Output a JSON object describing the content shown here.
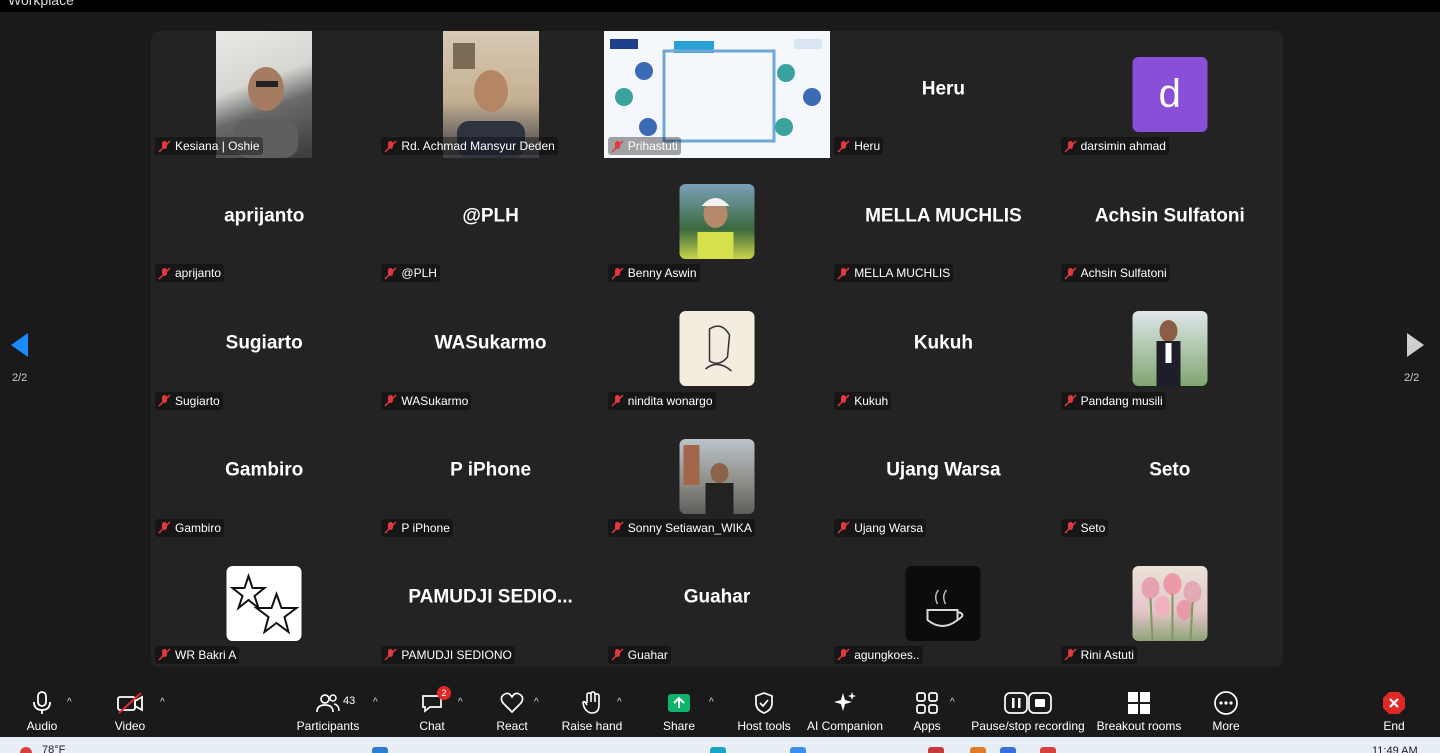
{
  "window": {
    "title": "Workplace"
  },
  "pagination": {
    "current_left": "2/2",
    "current_right": "2/2"
  },
  "participants": [
    {
      "name": "Kesiana | Oshie",
      "display": "",
      "kind": "video"
    },
    {
      "name": "Rd. Achmad Mansyur Deden",
      "display": "",
      "kind": "video"
    },
    {
      "name": "Prihastuti",
      "display": "",
      "kind": "share"
    },
    {
      "name": "Heru",
      "display": "Heru",
      "kind": "text"
    },
    {
      "name": "darsimin ahmad",
      "display": "d",
      "kind": "letter"
    },
    {
      "name": "aprijanto",
      "display": "aprijanto",
      "kind": "text"
    },
    {
      "name": "@PLH",
      "display": "@PLH",
      "kind": "text"
    },
    {
      "name": "Benny Aswin",
      "display": "",
      "kind": "avatar"
    },
    {
      "name": "MELLA MUCHLIS",
      "display": "MELLA MUCHLIS",
      "kind": "text"
    },
    {
      "name": "Achsin Sulfatoni",
      "display": "Achsin Sulfatoni",
      "kind": "text"
    },
    {
      "name": "Sugiarto",
      "display": "Sugiarto",
      "kind": "text"
    },
    {
      "name": "WASukarmo",
      "display": "WASukarmo",
      "kind": "text"
    },
    {
      "name": "nindita wonargo",
      "display": "",
      "kind": "avatar"
    },
    {
      "name": "Kukuh",
      "display": "Kukuh",
      "kind": "text"
    },
    {
      "name": "Pandang musili",
      "display": "",
      "kind": "avatar"
    },
    {
      "name": "Gambiro",
      "display": "Gambiro",
      "kind": "text"
    },
    {
      "name": "P iPhone",
      "display": "P iPhone",
      "kind": "text"
    },
    {
      "name": "Sonny Setiawan_WIKA",
      "display": "",
      "kind": "avatar"
    },
    {
      "name": "Ujang Warsa",
      "display": "Ujang Warsa",
      "kind": "text"
    },
    {
      "name": "Seto",
      "display": "Seto",
      "kind": "text"
    },
    {
      "name": "WR Bakri A",
      "display": "",
      "kind": "avatar"
    },
    {
      "name": "PAMUDJI SEDIONO",
      "display": "PAMUDJI SEDIO...",
      "kind": "text"
    },
    {
      "name": "Guahar",
      "display": "Guahar",
      "kind": "text"
    },
    {
      "name": "agungkoes..",
      "display": "",
      "kind": "avatar"
    },
    {
      "name": "Rini Astuti",
      "display": "",
      "kind": "avatar"
    }
  ],
  "toolbar": {
    "audio": "Audio",
    "video": "Video",
    "participants": "Participants",
    "participants_count": "43",
    "chat": "Chat",
    "chat_badge": "2",
    "react": "React",
    "raise_hand": "Raise hand",
    "share": "Share",
    "host_tools": "Host tools",
    "ai_companion": "AI Companion",
    "apps": "Apps",
    "pause_recording": "Pause/stop recording",
    "breakout_rooms": "Breakout rooms",
    "more": "More",
    "end": "End"
  },
  "taskbar": {
    "weather": "78°F",
    "clock": "11:49 AM"
  },
  "colors": {
    "letter_avatar": "#8a4fd8",
    "share_green": "#0fb36b",
    "end_red": "#e02828",
    "mute_red": "#e0393e"
  }
}
